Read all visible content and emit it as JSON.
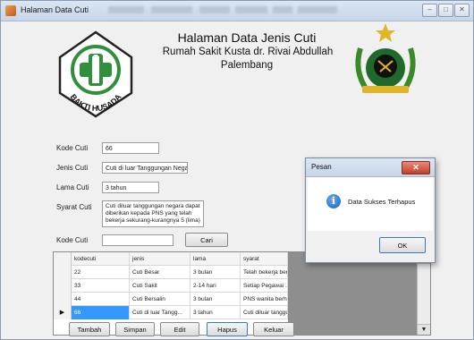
{
  "window": {
    "title": "Halaman Data Cuti",
    "minimize_glyph": "‒",
    "maximize_glyph": "□",
    "close_glyph": "✕"
  },
  "header": {
    "line1": "Halaman Data Jenis Cuti",
    "line2": "Rumah Sakit Kusta dr. Rivai Abdullah",
    "line3": "Palembang"
  },
  "logos": {
    "left": {
      "icon": "bakti-husada-logo",
      "text": "BAKTI HUSADA"
    },
    "right": {
      "icon": "hospital-emblem-logo"
    }
  },
  "form": {
    "kode_label": "Kode Cuti",
    "kode_value": "66",
    "jenis_label": "Jenis Cuti",
    "jenis_value": "Cuti di luar Tanggungan Negara",
    "lama_label": "Lama Cuti",
    "lama_value": "3 tahun",
    "syarat_label": "Syarat Cuti",
    "syarat_value": "Cuti diluar tanggungan negara dapat\ndiberikan kepada PNS yang telah\nbekerja sekurang-kurangnya 5 (lima)"
  },
  "search": {
    "label": "Kode Cuti",
    "value": "",
    "button": "Cari"
  },
  "grid": {
    "columns": [
      "kodecuti",
      "jenis",
      "lama",
      "syarat"
    ],
    "rows": [
      {
        "kodecuti": "22",
        "jenis": "Cuti Besar",
        "lama": "3 bulan",
        "syarat": "Telah bekerja ber..."
      },
      {
        "kodecuti": "33",
        "jenis": "Cuti Sakit",
        "lama": "2-14 hari",
        "syarat": "Setiap Pegawai ..."
      },
      {
        "kodecuti": "44",
        "jenis": "Cuti Bersalin",
        "lama": "3 bulan",
        "syarat": "PNS wanita berh..."
      },
      {
        "kodecuti": "66",
        "jenis": "Cuti di luar Tangg...",
        "lama": "3 tahun",
        "syarat": "Cuti diluar tanggu..."
      }
    ],
    "selected_row_marker": "▶",
    "scroll_up": "▲",
    "scroll_down": "▼"
  },
  "buttons": {
    "tambah": "Tambah",
    "simpan": "Simpan",
    "edit": "Edit",
    "hapus": "Hapus",
    "keluar": "Keluar"
  },
  "dialog": {
    "title": "Pesan",
    "message": "Data Sukses Terhapus",
    "icon": "information-icon",
    "icon_glyph": "i",
    "ok": "OK",
    "close_glyph": "✕"
  },
  "colors": {
    "selected_cell": "#3399ff",
    "logo_green": "#2f8f3a",
    "dialog_close": "#c2402b"
  }
}
